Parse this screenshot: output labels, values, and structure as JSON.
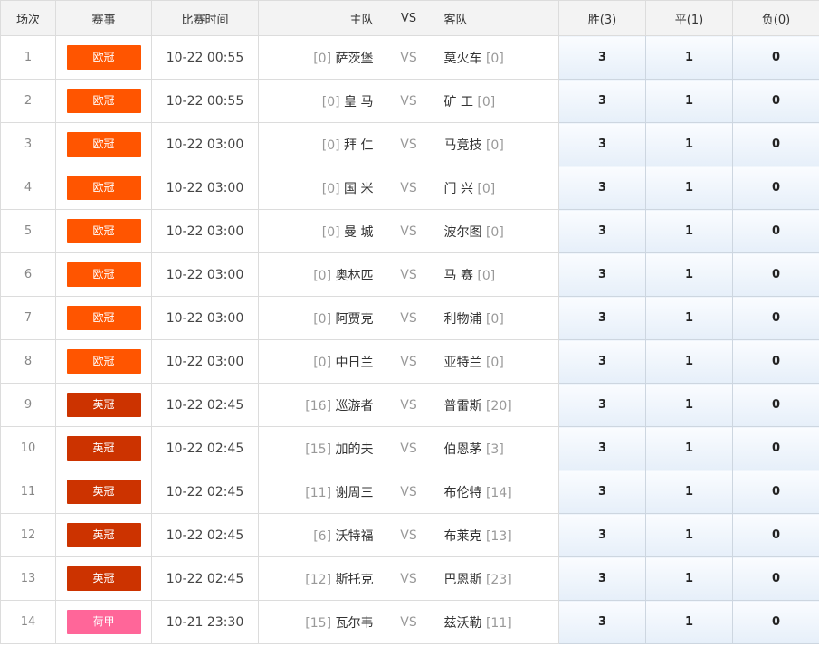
{
  "header": {
    "index": "场次",
    "league": "赛事",
    "time": "比赛时间",
    "home": "主队",
    "vs": "VS",
    "away": "客队",
    "win": "胜(3)",
    "draw": "平(1)",
    "lose": "负(0)"
  },
  "colors": {
    "欧冠": "#ff5500",
    "英冠": "#cc3300",
    "荷甲": "#ff6699"
  },
  "rows": [
    {
      "idx": "1",
      "league": "欧冠",
      "time": "10-22 00:55",
      "home_rank": "[0]",
      "home": "萨茨堡",
      "away": "莫火车",
      "away_rank": "[0]",
      "win": "3",
      "draw": "1",
      "lose": "0"
    },
    {
      "idx": "2",
      "league": "欧冠",
      "time": "10-22 00:55",
      "home_rank": "[0]",
      "home": "皇 马",
      "away": "矿 工",
      "away_rank": "[0]",
      "win": "3",
      "draw": "1",
      "lose": "0"
    },
    {
      "idx": "3",
      "league": "欧冠",
      "time": "10-22 03:00",
      "home_rank": "[0]",
      "home": "拜 仁",
      "away": "马竞技",
      "away_rank": "[0]",
      "win": "3",
      "draw": "1",
      "lose": "0"
    },
    {
      "idx": "4",
      "league": "欧冠",
      "time": "10-22 03:00",
      "home_rank": "[0]",
      "home": "国 米",
      "away": "门 兴",
      "away_rank": "[0]",
      "win": "3",
      "draw": "1",
      "lose": "0"
    },
    {
      "idx": "5",
      "league": "欧冠",
      "time": "10-22 03:00",
      "home_rank": "[0]",
      "home": "曼 城",
      "away": "波尔图",
      "away_rank": "[0]",
      "win": "3",
      "draw": "1",
      "lose": "0"
    },
    {
      "idx": "6",
      "league": "欧冠",
      "time": "10-22 03:00",
      "home_rank": "[0]",
      "home": "奥林匹",
      "away": "马 赛",
      "away_rank": "[0]",
      "win": "3",
      "draw": "1",
      "lose": "0"
    },
    {
      "idx": "7",
      "league": "欧冠",
      "time": "10-22 03:00",
      "home_rank": "[0]",
      "home": "阿贾克",
      "away": "利物浦",
      "away_rank": "[0]",
      "win": "3",
      "draw": "1",
      "lose": "0"
    },
    {
      "idx": "8",
      "league": "欧冠",
      "time": "10-22 03:00",
      "home_rank": "[0]",
      "home": "中日兰",
      "away": "亚特兰",
      "away_rank": "[0]",
      "win": "3",
      "draw": "1",
      "lose": "0"
    },
    {
      "idx": "9",
      "league": "英冠",
      "time": "10-22 02:45",
      "home_rank": "[16]",
      "home": "巡游者",
      "away": "普雷斯",
      "away_rank": "[20]",
      "win": "3",
      "draw": "1",
      "lose": "0"
    },
    {
      "idx": "10",
      "league": "英冠",
      "time": "10-22 02:45",
      "home_rank": "[15]",
      "home": "加的夫",
      "away": "伯恩茅",
      "away_rank": "[3]",
      "win": "3",
      "draw": "1",
      "lose": "0"
    },
    {
      "idx": "11",
      "league": "英冠",
      "time": "10-22 02:45",
      "home_rank": "[11]",
      "home": "谢周三",
      "away": "布伦特",
      "away_rank": "[14]",
      "win": "3",
      "draw": "1",
      "lose": "0"
    },
    {
      "idx": "12",
      "league": "英冠",
      "time": "10-22 02:45",
      "home_rank": "[6]",
      "home": "沃特福",
      "away": "布莱克",
      "away_rank": "[13]",
      "win": "3",
      "draw": "1",
      "lose": "0"
    },
    {
      "idx": "13",
      "league": "英冠",
      "time": "10-22 02:45",
      "home_rank": "[12]",
      "home": "斯托克",
      "away": "巴恩斯",
      "away_rank": "[23]",
      "win": "3",
      "draw": "1",
      "lose": "0"
    },
    {
      "idx": "14",
      "league": "荷甲",
      "time": "10-21 23:30",
      "home_rank": "[15]",
      "home": "瓦尔韦",
      "away": "兹沃勒",
      "away_rank": "[11]",
      "win": "3",
      "draw": "1",
      "lose": "0"
    }
  ]
}
